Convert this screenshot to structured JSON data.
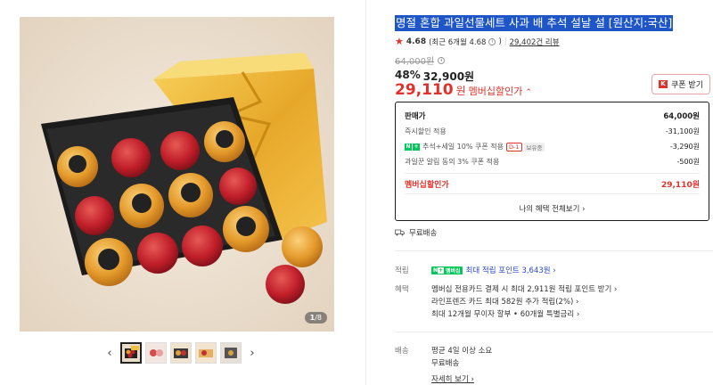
{
  "gallery": {
    "page_current": "1",
    "page_total": "/8",
    "prev_icon": "‹",
    "next_icon": "›",
    "thumb_count": 5
  },
  "product": {
    "title": "명절 혼합 과일선물세트 사과 배 추석 설날 설 [원산지:국산]",
    "rating": "4.68",
    "rating_recent": "(최근 6개월 4.68",
    "rating_recent_close": ")",
    "review_count": "29,402건 리뷰",
    "original_price": "64,000원",
    "discount_rate": "48%",
    "sale_price": "32,900원",
    "member_price": "29,110",
    "member_price_unit": "원",
    "member_price_label": "멤버십할인가",
    "coupon_label": "쿠폰 받기",
    "coupon_icon": "K"
  },
  "price_box": {
    "rows": [
      {
        "label": "판매가",
        "value": "64,000원"
      },
      {
        "label": "즉시할인 적용",
        "value": "-31,100원"
      },
      {
        "label": "추석+세일 10% 쿠폰 적용",
        "tag": "D-1",
        "tag2": "보유중",
        "value": "-3,290원"
      },
      {
        "label": "과일꾼 알림 동의 3% 쿠폰 적용",
        "value": "-500원"
      }
    ],
    "total_label": "멤버십할인가",
    "total_value": "29,110원",
    "benefit_all": "나의 혜택 전체보기 ›",
    "npay_n": "N",
    "npay_plus": "+"
  },
  "shipping_free": "무료배송",
  "points": {
    "label": "적립",
    "badge_n": "N",
    "badge_plus": "+",
    "badge_text": "멤버십",
    "text": "최대 적립 포인트 3,643원 ›"
  },
  "benefits": {
    "label": "혜택",
    "lines": [
      "멤버십 전용카드 결제 시 최대 2,911원 적립 포인트 받기 ›",
      "라인프렌즈 카드 최대 582원 추가 적립(2%) ›",
      "최대 12개월 무이자 할부 • 60개월 특별금리 ›"
    ]
  },
  "delivery": {
    "label": "배송",
    "line1": "평균 4일 이상 소요",
    "line2": "무료배송",
    "detail": "자세히 보기 ›"
  },
  "colors": {
    "accent_red": "#e2312a",
    "title_highlight": "#1e56c8",
    "npay_green": "#03c75a",
    "link_blue": "#2a47c9"
  }
}
